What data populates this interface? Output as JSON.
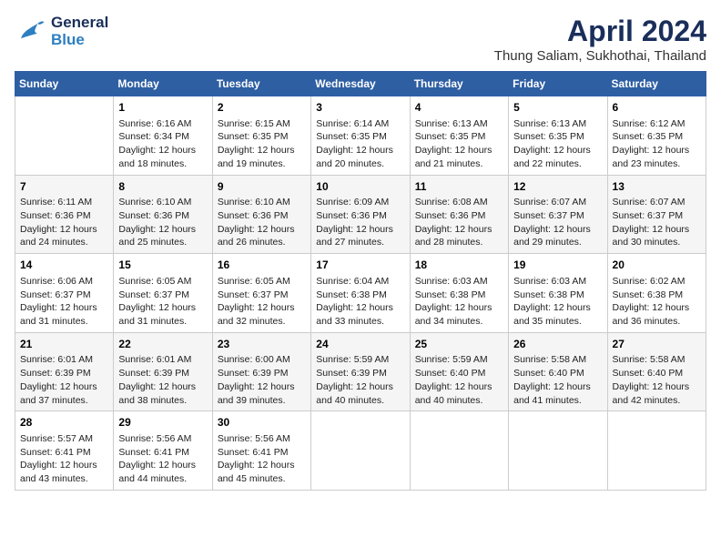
{
  "header": {
    "logo_line1": "General",
    "logo_line2": "Blue",
    "month": "April 2024",
    "location": "Thung Saliam, Sukhothai, Thailand"
  },
  "weekdays": [
    "Sunday",
    "Monday",
    "Tuesday",
    "Wednesday",
    "Thursday",
    "Friday",
    "Saturday"
  ],
  "weeks": [
    [
      {
        "day": "",
        "sunrise": "",
        "sunset": "",
        "daylight": ""
      },
      {
        "day": "1",
        "sunrise": "Sunrise: 6:16 AM",
        "sunset": "Sunset: 6:34 PM",
        "daylight": "Daylight: 12 hours and 18 minutes."
      },
      {
        "day": "2",
        "sunrise": "Sunrise: 6:15 AM",
        "sunset": "Sunset: 6:35 PM",
        "daylight": "Daylight: 12 hours and 19 minutes."
      },
      {
        "day": "3",
        "sunrise": "Sunrise: 6:14 AM",
        "sunset": "Sunset: 6:35 PM",
        "daylight": "Daylight: 12 hours and 20 minutes."
      },
      {
        "day": "4",
        "sunrise": "Sunrise: 6:13 AM",
        "sunset": "Sunset: 6:35 PM",
        "daylight": "Daylight: 12 hours and 21 minutes."
      },
      {
        "day": "5",
        "sunrise": "Sunrise: 6:13 AM",
        "sunset": "Sunset: 6:35 PM",
        "daylight": "Daylight: 12 hours and 22 minutes."
      },
      {
        "day": "6",
        "sunrise": "Sunrise: 6:12 AM",
        "sunset": "Sunset: 6:35 PM",
        "daylight": "Daylight: 12 hours and 23 minutes."
      }
    ],
    [
      {
        "day": "7",
        "sunrise": "Sunrise: 6:11 AM",
        "sunset": "Sunset: 6:36 PM",
        "daylight": "Daylight: 12 hours and 24 minutes."
      },
      {
        "day": "8",
        "sunrise": "Sunrise: 6:10 AM",
        "sunset": "Sunset: 6:36 PM",
        "daylight": "Daylight: 12 hours and 25 minutes."
      },
      {
        "day": "9",
        "sunrise": "Sunrise: 6:10 AM",
        "sunset": "Sunset: 6:36 PM",
        "daylight": "Daylight: 12 hours and 26 minutes."
      },
      {
        "day": "10",
        "sunrise": "Sunrise: 6:09 AM",
        "sunset": "Sunset: 6:36 PM",
        "daylight": "Daylight: 12 hours and 27 minutes."
      },
      {
        "day": "11",
        "sunrise": "Sunrise: 6:08 AM",
        "sunset": "Sunset: 6:36 PM",
        "daylight": "Daylight: 12 hours and 28 minutes."
      },
      {
        "day": "12",
        "sunrise": "Sunrise: 6:07 AM",
        "sunset": "Sunset: 6:37 PM",
        "daylight": "Daylight: 12 hours and 29 minutes."
      },
      {
        "day": "13",
        "sunrise": "Sunrise: 6:07 AM",
        "sunset": "Sunset: 6:37 PM",
        "daylight": "Daylight: 12 hours and 30 minutes."
      }
    ],
    [
      {
        "day": "14",
        "sunrise": "Sunrise: 6:06 AM",
        "sunset": "Sunset: 6:37 PM",
        "daylight": "Daylight: 12 hours and 31 minutes."
      },
      {
        "day": "15",
        "sunrise": "Sunrise: 6:05 AM",
        "sunset": "Sunset: 6:37 PM",
        "daylight": "Daylight: 12 hours and 31 minutes."
      },
      {
        "day": "16",
        "sunrise": "Sunrise: 6:05 AM",
        "sunset": "Sunset: 6:37 PM",
        "daylight": "Daylight: 12 hours and 32 minutes."
      },
      {
        "day": "17",
        "sunrise": "Sunrise: 6:04 AM",
        "sunset": "Sunset: 6:38 PM",
        "daylight": "Daylight: 12 hours and 33 minutes."
      },
      {
        "day": "18",
        "sunrise": "Sunrise: 6:03 AM",
        "sunset": "Sunset: 6:38 PM",
        "daylight": "Daylight: 12 hours and 34 minutes."
      },
      {
        "day": "19",
        "sunrise": "Sunrise: 6:03 AM",
        "sunset": "Sunset: 6:38 PM",
        "daylight": "Daylight: 12 hours and 35 minutes."
      },
      {
        "day": "20",
        "sunrise": "Sunrise: 6:02 AM",
        "sunset": "Sunset: 6:38 PM",
        "daylight": "Daylight: 12 hours and 36 minutes."
      }
    ],
    [
      {
        "day": "21",
        "sunrise": "Sunrise: 6:01 AM",
        "sunset": "Sunset: 6:39 PM",
        "daylight": "Daylight: 12 hours and 37 minutes."
      },
      {
        "day": "22",
        "sunrise": "Sunrise: 6:01 AM",
        "sunset": "Sunset: 6:39 PM",
        "daylight": "Daylight: 12 hours and 38 minutes."
      },
      {
        "day": "23",
        "sunrise": "Sunrise: 6:00 AM",
        "sunset": "Sunset: 6:39 PM",
        "daylight": "Daylight: 12 hours and 39 minutes."
      },
      {
        "day": "24",
        "sunrise": "Sunrise: 5:59 AM",
        "sunset": "Sunset: 6:39 PM",
        "daylight": "Daylight: 12 hours and 40 minutes."
      },
      {
        "day": "25",
        "sunrise": "Sunrise: 5:59 AM",
        "sunset": "Sunset: 6:40 PM",
        "daylight": "Daylight: 12 hours and 40 minutes."
      },
      {
        "day": "26",
        "sunrise": "Sunrise: 5:58 AM",
        "sunset": "Sunset: 6:40 PM",
        "daylight": "Daylight: 12 hours and 41 minutes."
      },
      {
        "day": "27",
        "sunrise": "Sunrise: 5:58 AM",
        "sunset": "Sunset: 6:40 PM",
        "daylight": "Daylight: 12 hours and 42 minutes."
      }
    ],
    [
      {
        "day": "28",
        "sunrise": "Sunrise: 5:57 AM",
        "sunset": "Sunset: 6:41 PM",
        "daylight": "Daylight: 12 hours and 43 minutes."
      },
      {
        "day": "29",
        "sunrise": "Sunrise: 5:56 AM",
        "sunset": "Sunset: 6:41 PM",
        "daylight": "Daylight: 12 hours and 44 minutes."
      },
      {
        "day": "30",
        "sunrise": "Sunrise: 5:56 AM",
        "sunset": "Sunset: 6:41 PM",
        "daylight": "Daylight: 12 hours and 45 minutes."
      },
      {
        "day": "",
        "sunrise": "",
        "sunset": "",
        "daylight": ""
      },
      {
        "day": "",
        "sunrise": "",
        "sunset": "",
        "daylight": ""
      },
      {
        "day": "",
        "sunrise": "",
        "sunset": "",
        "daylight": ""
      },
      {
        "day": "",
        "sunrise": "",
        "sunset": "",
        "daylight": ""
      }
    ]
  ]
}
